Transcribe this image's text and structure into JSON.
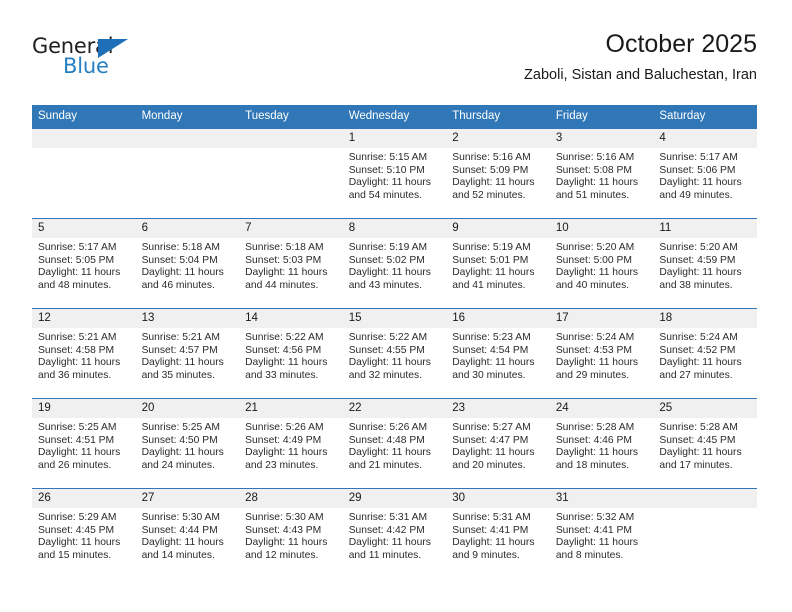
{
  "brand": {
    "name_top": "General",
    "name_bottom": "Blue",
    "color_dark": "#231f20",
    "color_blue": "#2680c2"
  },
  "header": {
    "title": "October 2025",
    "subtitle": "Zaboli, Sistan and Baluchestan, Iran"
  },
  "theme": {
    "header_bg": "#3077b7",
    "daynum_bg": "#f0f0f0",
    "row_rule": "#3077b7",
    "text": "#2b2b2b"
  },
  "calendar": {
    "weekday_headers": [
      "Sunday",
      "Monday",
      "Tuesday",
      "Wednesday",
      "Thursday",
      "Friday",
      "Saturday"
    ],
    "weeks": [
      [
        {
          "day": "",
          "blank": true,
          "sunrise": "",
          "sunset": "",
          "daylight_line1": "",
          "daylight_line2": ""
        },
        {
          "day": "",
          "blank": true,
          "sunrise": "",
          "sunset": "",
          "daylight_line1": "",
          "daylight_line2": ""
        },
        {
          "day": "",
          "blank": true,
          "sunrise": "",
          "sunset": "",
          "daylight_line1": "",
          "daylight_line2": ""
        },
        {
          "day": "1",
          "blank": false,
          "sunrise": "Sunrise: 5:15 AM",
          "sunset": "Sunset: 5:10 PM",
          "daylight_line1": "Daylight: 11 hours",
          "daylight_line2": "and 54 minutes."
        },
        {
          "day": "2",
          "blank": false,
          "sunrise": "Sunrise: 5:16 AM",
          "sunset": "Sunset: 5:09 PM",
          "daylight_line1": "Daylight: 11 hours",
          "daylight_line2": "and 52 minutes."
        },
        {
          "day": "3",
          "blank": false,
          "sunrise": "Sunrise: 5:16 AM",
          "sunset": "Sunset: 5:08 PM",
          "daylight_line1": "Daylight: 11 hours",
          "daylight_line2": "and 51 minutes."
        },
        {
          "day": "4",
          "blank": false,
          "sunrise": "Sunrise: 5:17 AM",
          "sunset": "Sunset: 5:06 PM",
          "daylight_line1": "Daylight: 11 hours",
          "daylight_line2": "and 49 minutes."
        }
      ],
      [
        {
          "day": "5",
          "blank": false,
          "sunrise": "Sunrise: 5:17 AM",
          "sunset": "Sunset: 5:05 PM",
          "daylight_line1": "Daylight: 11 hours",
          "daylight_line2": "and 48 minutes."
        },
        {
          "day": "6",
          "blank": false,
          "sunrise": "Sunrise: 5:18 AM",
          "sunset": "Sunset: 5:04 PM",
          "daylight_line1": "Daylight: 11 hours",
          "daylight_line2": "and 46 minutes."
        },
        {
          "day": "7",
          "blank": false,
          "sunrise": "Sunrise: 5:18 AM",
          "sunset": "Sunset: 5:03 PM",
          "daylight_line1": "Daylight: 11 hours",
          "daylight_line2": "and 44 minutes."
        },
        {
          "day": "8",
          "blank": false,
          "sunrise": "Sunrise: 5:19 AM",
          "sunset": "Sunset: 5:02 PM",
          "daylight_line1": "Daylight: 11 hours",
          "daylight_line2": "and 43 minutes."
        },
        {
          "day": "9",
          "blank": false,
          "sunrise": "Sunrise: 5:19 AM",
          "sunset": "Sunset: 5:01 PM",
          "daylight_line1": "Daylight: 11 hours",
          "daylight_line2": "and 41 minutes."
        },
        {
          "day": "10",
          "blank": false,
          "sunrise": "Sunrise: 5:20 AM",
          "sunset": "Sunset: 5:00 PM",
          "daylight_line1": "Daylight: 11 hours",
          "daylight_line2": "and 40 minutes."
        },
        {
          "day": "11",
          "blank": false,
          "sunrise": "Sunrise: 5:20 AM",
          "sunset": "Sunset: 4:59 PM",
          "daylight_line1": "Daylight: 11 hours",
          "daylight_line2": "and 38 minutes."
        }
      ],
      [
        {
          "day": "12",
          "blank": false,
          "sunrise": "Sunrise: 5:21 AM",
          "sunset": "Sunset: 4:58 PM",
          "daylight_line1": "Daylight: 11 hours",
          "daylight_line2": "and 36 minutes."
        },
        {
          "day": "13",
          "blank": false,
          "sunrise": "Sunrise: 5:21 AM",
          "sunset": "Sunset: 4:57 PM",
          "daylight_line1": "Daylight: 11 hours",
          "daylight_line2": "and 35 minutes."
        },
        {
          "day": "14",
          "blank": false,
          "sunrise": "Sunrise: 5:22 AM",
          "sunset": "Sunset: 4:56 PM",
          "daylight_line1": "Daylight: 11 hours",
          "daylight_line2": "and 33 minutes."
        },
        {
          "day": "15",
          "blank": false,
          "sunrise": "Sunrise: 5:22 AM",
          "sunset": "Sunset: 4:55 PM",
          "daylight_line1": "Daylight: 11 hours",
          "daylight_line2": "and 32 minutes."
        },
        {
          "day": "16",
          "blank": false,
          "sunrise": "Sunrise: 5:23 AM",
          "sunset": "Sunset: 4:54 PM",
          "daylight_line1": "Daylight: 11 hours",
          "daylight_line2": "and 30 minutes."
        },
        {
          "day": "17",
          "blank": false,
          "sunrise": "Sunrise: 5:24 AM",
          "sunset": "Sunset: 4:53 PM",
          "daylight_line1": "Daylight: 11 hours",
          "daylight_line2": "and 29 minutes."
        },
        {
          "day": "18",
          "blank": false,
          "sunrise": "Sunrise: 5:24 AM",
          "sunset": "Sunset: 4:52 PM",
          "daylight_line1": "Daylight: 11 hours",
          "daylight_line2": "and 27 minutes."
        }
      ],
      [
        {
          "day": "19",
          "blank": false,
          "sunrise": "Sunrise: 5:25 AM",
          "sunset": "Sunset: 4:51 PM",
          "daylight_line1": "Daylight: 11 hours",
          "daylight_line2": "and 26 minutes."
        },
        {
          "day": "20",
          "blank": false,
          "sunrise": "Sunrise: 5:25 AM",
          "sunset": "Sunset: 4:50 PM",
          "daylight_line1": "Daylight: 11 hours",
          "daylight_line2": "and 24 minutes."
        },
        {
          "day": "21",
          "blank": false,
          "sunrise": "Sunrise: 5:26 AM",
          "sunset": "Sunset: 4:49 PM",
          "daylight_line1": "Daylight: 11 hours",
          "daylight_line2": "and 23 minutes."
        },
        {
          "day": "22",
          "blank": false,
          "sunrise": "Sunrise: 5:26 AM",
          "sunset": "Sunset: 4:48 PM",
          "daylight_line1": "Daylight: 11 hours",
          "daylight_line2": "and 21 minutes."
        },
        {
          "day": "23",
          "blank": false,
          "sunrise": "Sunrise: 5:27 AM",
          "sunset": "Sunset: 4:47 PM",
          "daylight_line1": "Daylight: 11 hours",
          "daylight_line2": "and 20 minutes."
        },
        {
          "day": "24",
          "blank": false,
          "sunrise": "Sunrise: 5:28 AM",
          "sunset": "Sunset: 4:46 PM",
          "daylight_line1": "Daylight: 11 hours",
          "daylight_line2": "and 18 minutes."
        },
        {
          "day": "25",
          "blank": false,
          "sunrise": "Sunrise: 5:28 AM",
          "sunset": "Sunset: 4:45 PM",
          "daylight_line1": "Daylight: 11 hours",
          "daylight_line2": "and 17 minutes."
        }
      ],
      [
        {
          "day": "26",
          "blank": false,
          "sunrise": "Sunrise: 5:29 AM",
          "sunset": "Sunset: 4:45 PM",
          "daylight_line1": "Daylight: 11 hours",
          "daylight_line2": "and 15 minutes."
        },
        {
          "day": "27",
          "blank": false,
          "sunrise": "Sunrise: 5:30 AM",
          "sunset": "Sunset: 4:44 PM",
          "daylight_line1": "Daylight: 11 hours",
          "daylight_line2": "and 14 minutes."
        },
        {
          "day": "28",
          "blank": false,
          "sunrise": "Sunrise: 5:30 AM",
          "sunset": "Sunset: 4:43 PM",
          "daylight_line1": "Daylight: 11 hours",
          "daylight_line2": "and 12 minutes."
        },
        {
          "day": "29",
          "blank": false,
          "sunrise": "Sunrise: 5:31 AM",
          "sunset": "Sunset: 4:42 PM",
          "daylight_line1": "Daylight: 11 hours",
          "daylight_line2": "and 11 minutes."
        },
        {
          "day": "30",
          "blank": false,
          "sunrise": "Sunrise: 5:31 AM",
          "sunset": "Sunset: 4:41 PM",
          "daylight_line1": "Daylight: 11 hours",
          "daylight_line2": "and 9 minutes."
        },
        {
          "day": "31",
          "blank": false,
          "sunrise": "Sunrise: 5:32 AM",
          "sunset": "Sunset: 4:41 PM",
          "daylight_line1": "Daylight: 11 hours",
          "daylight_line2": "and 8 minutes."
        },
        {
          "day": "",
          "blank": true,
          "sunrise": "",
          "sunset": "",
          "daylight_line1": "",
          "daylight_line2": ""
        }
      ]
    ]
  }
}
